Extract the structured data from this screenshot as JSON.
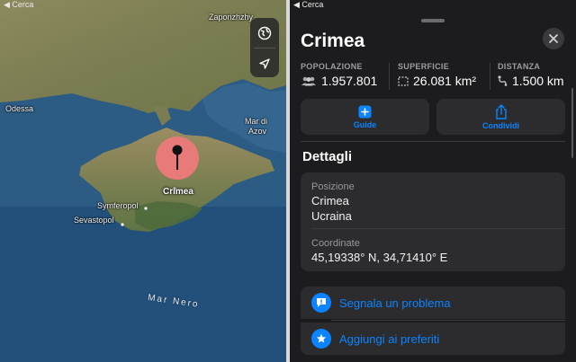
{
  "status_back": "◀ Cerca",
  "map": {
    "labels": {
      "zaporizhzhya": "Zaporizhzhy",
      "odessa": "Odessa",
      "azov_line1": "Mar di",
      "azov_line2": "Azov",
      "symferopol": "Symferopol",
      "sevastopol": "Sevastopol",
      "black_sea": "Mar Nero"
    },
    "pin_label": "Crimea",
    "controls": [
      "globe-icon",
      "location-arrow-icon"
    ]
  },
  "place": {
    "title": "Crimea",
    "stats": [
      {
        "label": "POPOLAZIONE",
        "value": "1.957.801",
        "icon": "people-icon"
      },
      {
        "label": "SUPERFICIE",
        "value": "26.081 km²",
        "icon": "area-icon"
      },
      {
        "label": "DISTANZA",
        "value": "1.500 km",
        "icon": "route-icon"
      }
    ],
    "actions": [
      {
        "label": "Guide",
        "icon": "plus-square-icon"
      },
      {
        "label": "Condividi",
        "icon": "share-icon"
      }
    ],
    "details_title": "Dettagli",
    "position_label": "Posizione",
    "position_lines": [
      "Crimea",
      "Ucraina"
    ],
    "coordinates_label": "Coordinate",
    "coordinates_value": "45,19338° N, 34,71410° E",
    "report_label": "Segnala un problema",
    "favorite_label": "Aggiungi ai preferiti"
  },
  "colors": {
    "accent": "#0a84ff",
    "pin": "#e97a7a",
    "sheet_bg": "#1c1c1e",
    "card_bg": "#2c2c2e"
  }
}
